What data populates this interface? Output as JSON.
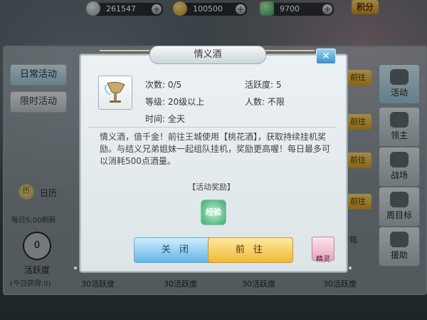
{
  "currency": {
    "silver": "261547",
    "gold": "100500",
    "gem": "9700",
    "plus": "+",
    "jifen": "积分"
  },
  "left_tabs": {
    "daily": "日常活动",
    "limited": "限时活动"
  },
  "left_panel": {
    "calendar_icon": "历",
    "calendar": "日历",
    "refresh": "每日5:00刷新",
    "activity_value": "0",
    "activity_label": "活跃度",
    "today_gain": "(今日获得:0)"
  },
  "right_nav": {
    "activity": "活动",
    "lord": "领主",
    "battle": "战场",
    "weekly": "周目标",
    "help": "援助"
  },
  "go_badge": "前往",
  "chest": "宝箱",
  "bottom_labels": [
    "30活跃度",
    "30活跃度",
    "30活跃度",
    "30活跃度"
  ],
  "dialog": {
    "title": "情义酒",
    "close": "✕",
    "count": "次数: 0/5",
    "activity": "活跃度: 5",
    "level": "等级: 20级以上",
    "people": "人数: 不限",
    "time": "时间: 全天",
    "description": "情义酒，值千金！前往王城使用【桃花酒】，获取持续挂机奖励。与结义兄弟姐妹一起组队挂机，奖励更高喔！每日最多可以消耗500点酒量。",
    "reward_title": "【活动奖励】",
    "reward_exp": "经验",
    "btn_close": "关 闭",
    "btn_go": "前 往",
    "sprite": "精灵"
  }
}
